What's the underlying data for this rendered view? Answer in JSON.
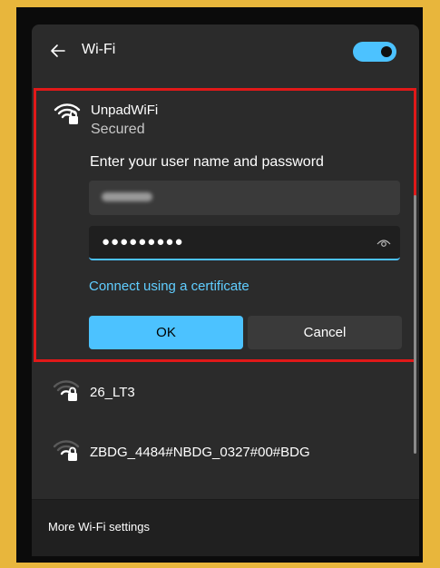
{
  "header": {
    "title": "Wi-Fi",
    "toggle_on": true
  },
  "expanded_network": {
    "name": "UnpadWiFi",
    "status": "Secured",
    "prompt": "Enter your user name and password",
    "password_mask": "●●●●●●●●●",
    "cert_link": "Connect using a certificate",
    "ok_label": "OK",
    "cancel_label": "Cancel"
  },
  "networks": [
    {
      "name": "26_LT3"
    },
    {
      "name": "ZBDG_4484#NBDG_0327#00#BDG"
    }
  ],
  "footer": {
    "link": "More Wi-Fi settings"
  },
  "colors": {
    "accent": "#4cc2ff",
    "highlight": "#e01919",
    "background": "#E8B63C"
  }
}
